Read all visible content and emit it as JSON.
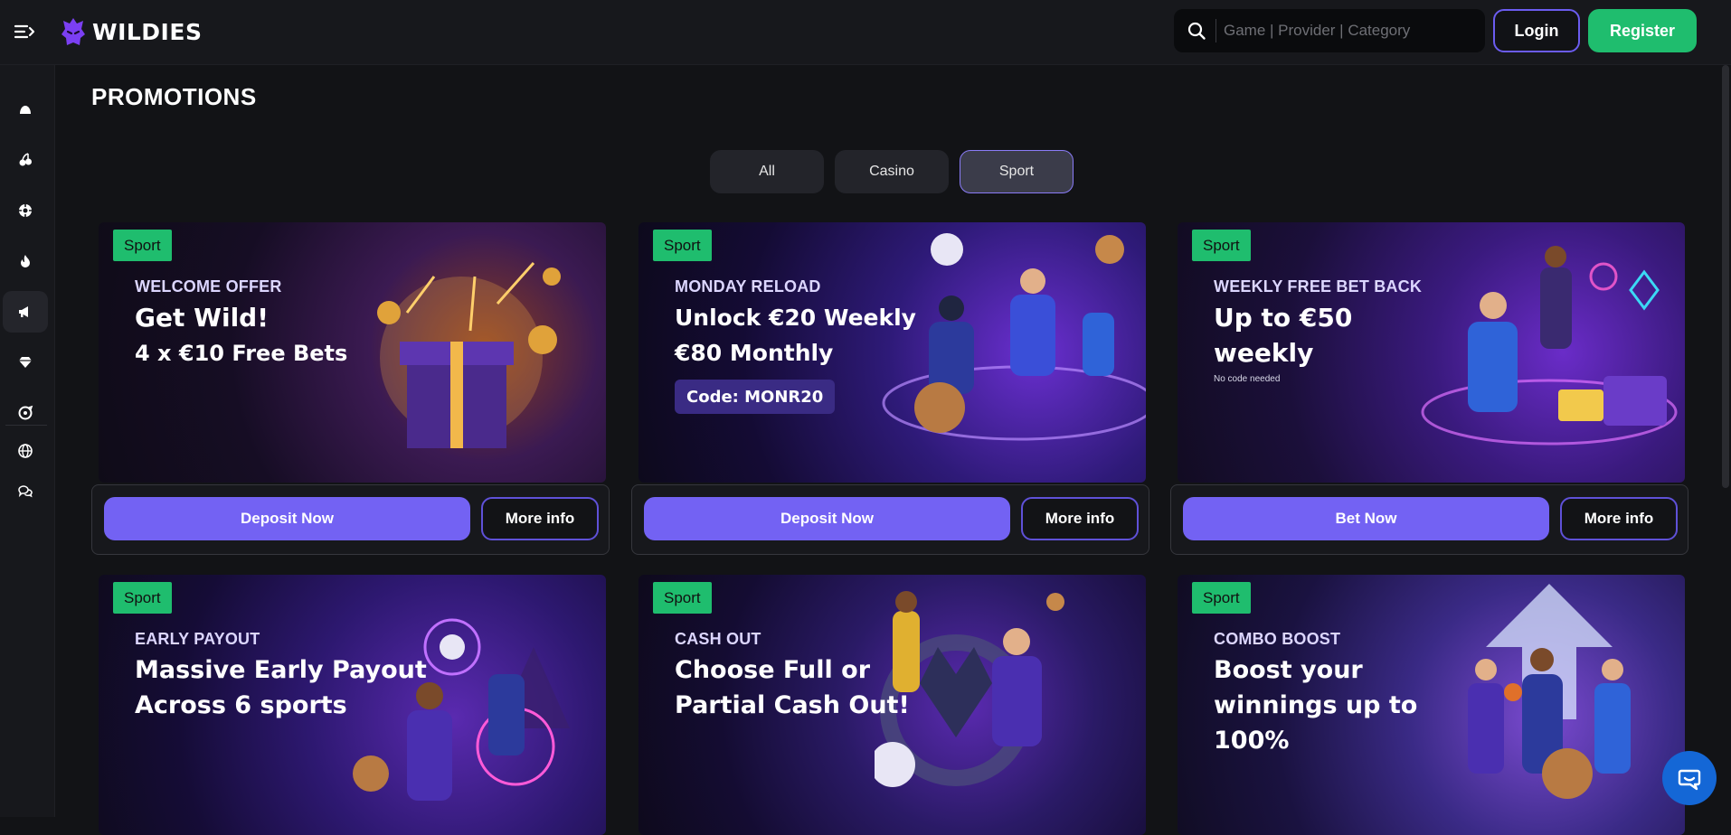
{
  "brand": {
    "name": "WILDIES",
    "accent": "#7362f3",
    "success": "#1fbd6e"
  },
  "header": {
    "search_placeholder": "Game | Provider | Category",
    "login_label": "Login",
    "register_label": "Register"
  },
  "sidebar": {
    "items": [
      {
        "icon": "home-icon"
      },
      {
        "icon": "cherries-icon"
      },
      {
        "icon": "casino-chip-icon"
      },
      {
        "icon": "fire-icon"
      },
      {
        "icon": "promotions-icon",
        "active": true
      },
      {
        "icon": "diamond-icon"
      },
      {
        "icon": "wheel-icon"
      }
    ],
    "bottom": [
      {
        "icon": "globe-icon"
      },
      {
        "icon": "chat-bubbles-icon"
      }
    ]
  },
  "page": {
    "title": "PROMOTIONS"
  },
  "tabs": [
    {
      "label": "All",
      "active": false
    },
    {
      "label": "Casino",
      "active": false
    },
    {
      "label": "Sport",
      "active": true
    }
  ],
  "promotions": [
    {
      "badge": "Sport",
      "eyebrow": "WELCOME OFFER",
      "headline": "Get Wild!",
      "subline": "4 x €10 Free Bets",
      "primary_label": "Deposit Now",
      "more_label": "More info"
    },
    {
      "badge": "Sport",
      "eyebrow": "MONDAY RELOAD",
      "headline": "Unlock €20 Weekly\n€80 Monthly",
      "code": "Code: MONR20",
      "primary_label": "Deposit Now",
      "more_label": "More info"
    },
    {
      "badge": "Sport",
      "eyebrow": "WEEKLY FREE BET BACK",
      "headline": "Up to €50\nweekly",
      "note": "No code needed",
      "primary_label": "Bet Now",
      "more_label": "More info"
    },
    {
      "badge": "Sport",
      "eyebrow": "EARLY PAYOUT",
      "headline": "Massive Early Payout\nAcross 6 sports"
    },
    {
      "badge": "Sport",
      "eyebrow": "CASH OUT",
      "headline": "Choose Full or\nPartial Cash Out!"
    },
    {
      "badge": "Sport",
      "eyebrow": "COMBO BOOST",
      "headline": "Boost your\nwinnings up to\n100%"
    }
  ]
}
